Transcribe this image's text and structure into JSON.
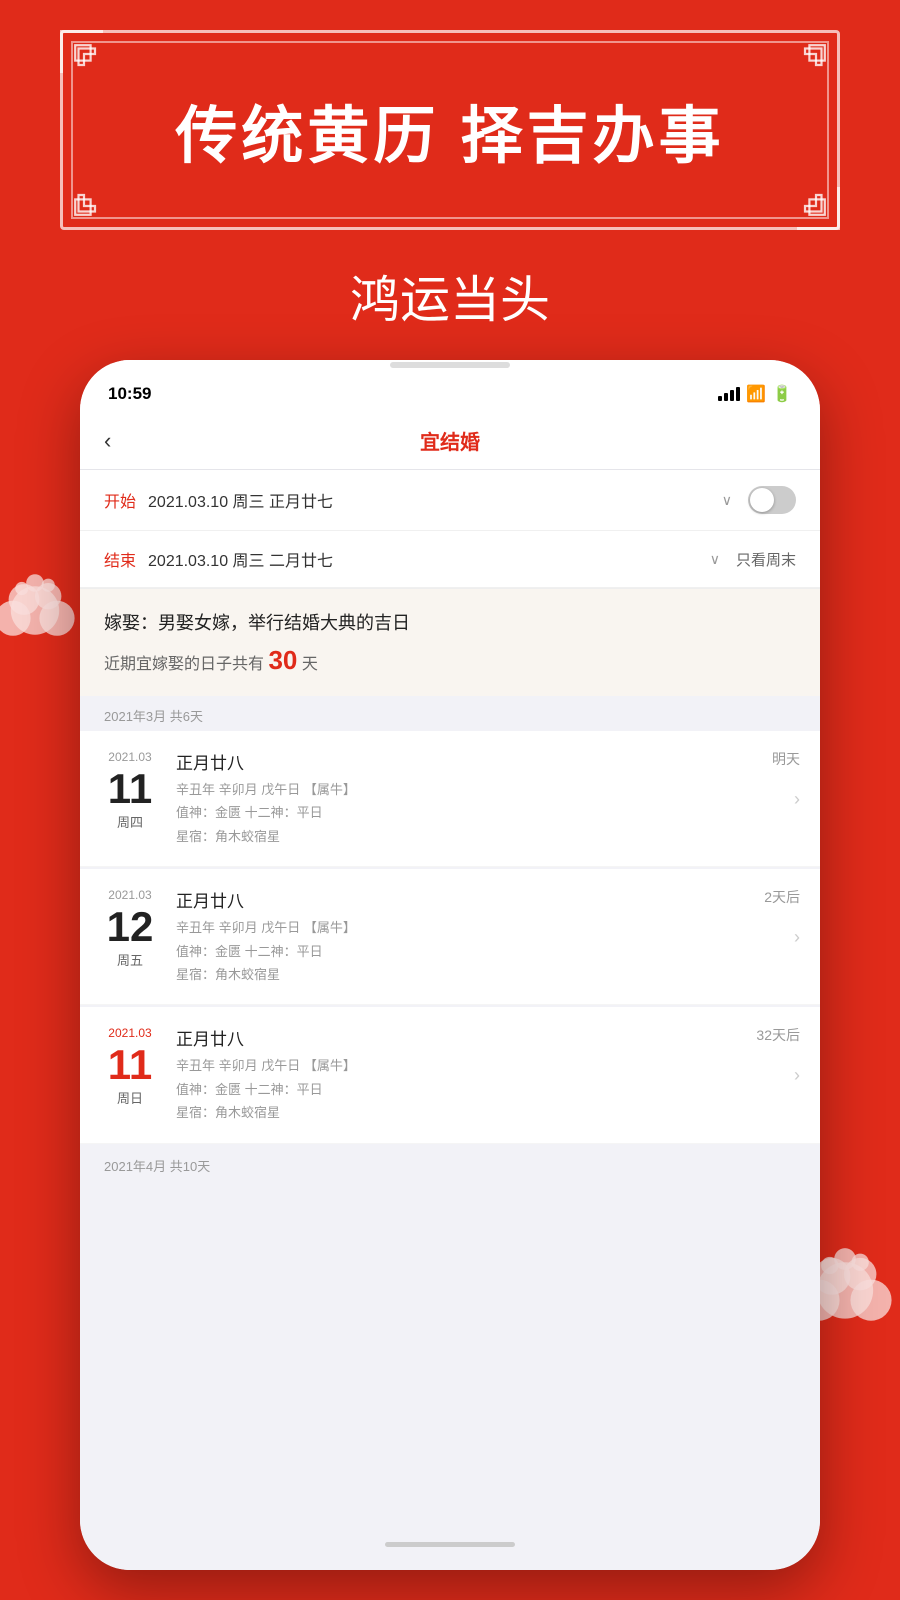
{
  "background": {
    "color": "#e02b1a"
  },
  "header": {
    "main_title": "传统黄历  择吉办事",
    "subtitle": "鸿运当头"
  },
  "phone": {
    "status_bar": {
      "time": "10:59"
    },
    "nav": {
      "back_label": "‹",
      "title": "宜结婚"
    },
    "date_start": {
      "label": "开始",
      "value": "2021.03.10  周三  正月廿七",
      "has_chevron": true
    },
    "date_end": {
      "label": "结束",
      "value": "2021.03.10  周三  二月廿七",
      "has_chevron": true,
      "weekend_label": "只看周末"
    },
    "description": {
      "title": "嫁娶：男娶女嫁，举行结婚大典的吉日",
      "subtitle_prefix": "近期宜嫁娶的日子共有",
      "count": "30",
      "subtitle_suffix": "天"
    },
    "month_groups": [
      {
        "label": "2021年3月  共6天",
        "items": [
          {
            "year_month": "2021.03",
            "day": "11",
            "weekday": "周四",
            "relative": "明天",
            "lunar": "正月廿八",
            "detail_line1": "辛丑年 辛卯月 戊午日 【属牛】",
            "detail_line2": "值神：金匮  十二神：平日",
            "detail_line3": "星宿：角木蛟宿星",
            "is_red": false
          },
          {
            "year_month": "2021.03",
            "day": "12",
            "weekday": "周五",
            "relative": "2天后",
            "lunar": "正月廿八",
            "detail_line1": "辛丑年 辛卯月 戊午日 【属牛】",
            "detail_line2": "值神：金匮  十二神：平日",
            "detail_line3": "星宿：角木蛟宿星",
            "is_red": false
          },
          {
            "year_month": "2021.03",
            "day": "11",
            "weekday": "周日",
            "relative": "32天后",
            "lunar": "正月廿八",
            "detail_line1": "辛丑年 辛卯月 戊午日 【属牛】",
            "detail_line2": "值神：金匮  十二神：平日",
            "detail_line3": "星宿：角木蛟宿星",
            "is_red": true
          }
        ]
      },
      {
        "label": "2021年4月  共10天",
        "items": []
      }
    ]
  }
}
